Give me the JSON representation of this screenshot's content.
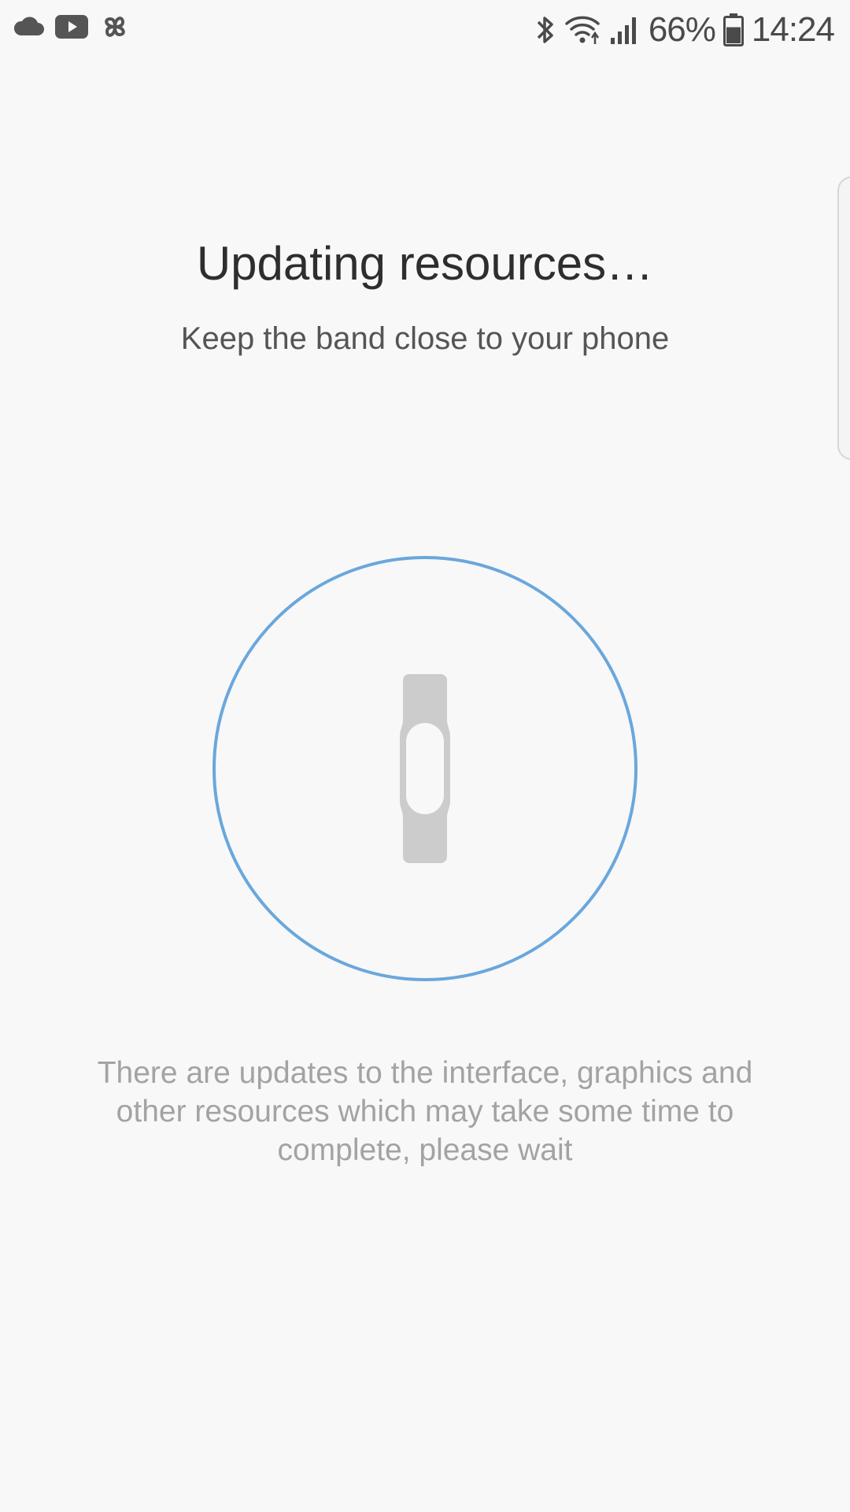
{
  "status_bar": {
    "left_icons": [
      "cloud-icon",
      "youtube-icon",
      "pinwheel-icon"
    ],
    "right_icons": [
      "bluetooth-icon",
      "wifi-icon",
      "signal-icon",
      "battery-icon"
    ],
    "battery_percent": "66%",
    "battery_level": 0.66,
    "time": "14:24"
  },
  "main": {
    "title": "Updating resources…",
    "subtitle": "Keep the band close to your phone",
    "illustration": {
      "ring_color": "#6aa7dc",
      "band_color": "#cccccc",
      "icon": "fitness-band-icon"
    },
    "description": "There are updates to the interface, graphics and other resources which may take some time to complete, please wait"
  },
  "colors": {
    "background": "#f8f8f8",
    "title_text": "#2e2e2e",
    "subtitle_text": "#555555",
    "description_text": "#a3a3a3",
    "accent": "#6aa7dc"
  }
}
